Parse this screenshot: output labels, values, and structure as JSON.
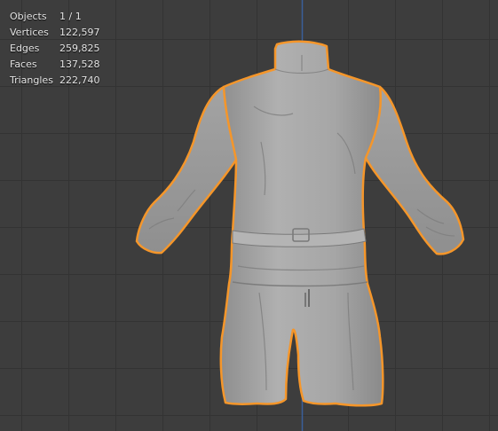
{
  "stats": {
    "objects": {
      "label": "Objects",
      "value": "1 / 1"
    },
    "vertices": {
      "label": "Vertices",
      "value": "122,597"
    },
    "edges": {
      "label": "Edges",
      "value": "259,825"
    },
    "faces": {
      "label": "Faces",
      "value": "137,528"
    },
    "triangles": {
      "label": "Triangles",
      "value": "222,740"
    }
  },
  "colors": {
    "background": "#3d3d3d",
    "grid": "#343434",
    "axis_y": "#3a5f9a",
    "selection_outline": "#f5962a",
    "mesh": "#a9a9a9"
  },
  "model": {
    "icon": "jumpsuit-mesh-icon"
  }
}
